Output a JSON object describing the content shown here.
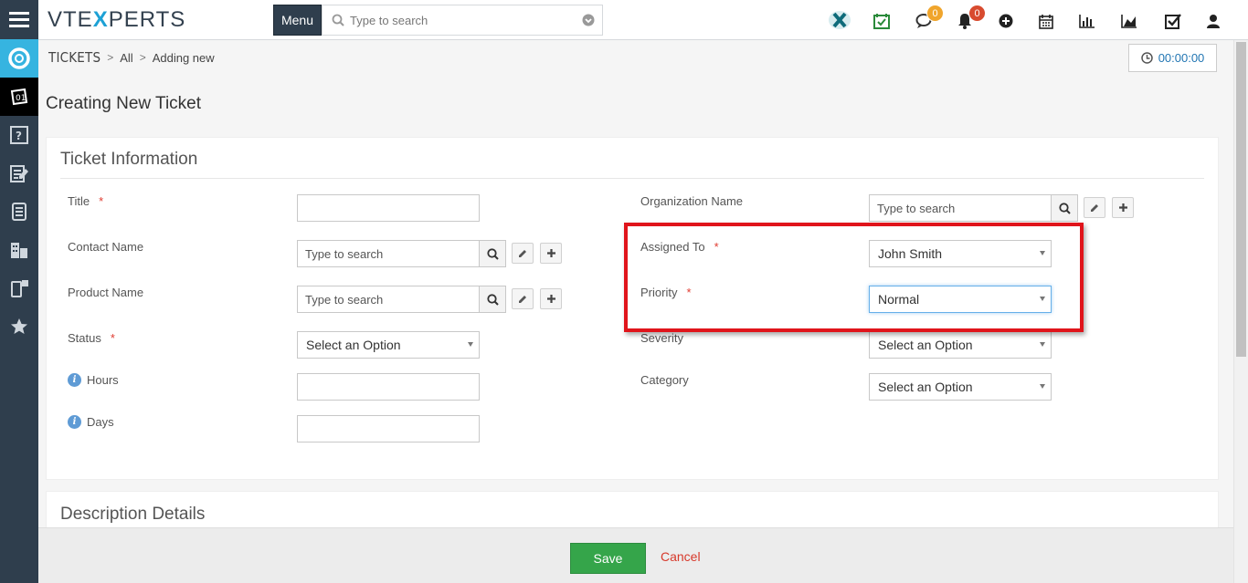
{
  "app": {
    "logo_left": "VTE",
    "logo_x": "X",
    "logo_right": "PERTS"
  },
  "topbar": {
    "menu_label": "Menu",
    "search_placeholder": "Type to search",
    "chat_badge": "0",
    "notif_badge": "0"
  },
  "breadcrumb": {
    "module": "TICKETS",
    "filter": "All",
    "action": "Adding new"
  },
  "timer": {
    "value": "00:00:00"
  },
  "page": {
    "title": "Creating New Ticket"
  },
  "ticket_info": {
    "heading": "Ticket Information",
    "title_label": "Title",
    "contact_label": "Contact Name",
    "contact_placeholder": "Type to search",
    "product_label": "Product Name",
    "product_placeholder": "Type to search",
    "status_label": "Status",
    "status_value": "Select an Option",
    "hours_label": "Hours",
    "days_label": "Days",
    "org_label": "Organization Name",
    "org_placeholder": "Type to search",
    "assigned_label": "Assigned To",
    "assigned_value": "John Smith",
    "priority_label": "Priority",
    "priority_value": "Normal",
    "severity_label": "Severity",
    "severity_value": "Select an Option",
    "category_label": "Category",
    "category_value": "Select an Option",
    "required_mark": "*"
  },
  "description": {
    "heading": "Description Details"
  },
  "footer": {
    "save_label": "Save",
    "cancel_label": "Cancel"
  },
  "colors": {
    "sidebar": "#2f3e4d",
    "save": "#35a54a",
    "highlight": "#e0141b",
    "required": "#e03c31"
  }
}
